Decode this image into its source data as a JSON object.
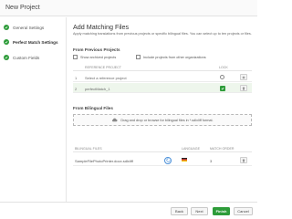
{
  "window": {
    "title": "New Project"
  },
  "steps": [
    {
      "label": "General Settings"
    },
    {
      "label": "Perfect Match Settings"
    },
    {
      "label": "Custom Fields"
    }
  ],
  "main": {
    "heading": "Add Matching Files",
    "description": "Apply matching translations from previous projects or specific bilingual files. You can select up to ten projects or files.",
    "previous_projects": {
      "heading": "From Previous Projects",
      "show_archived": "Show archived projects",
      "include_other_orgs": "Include projects from other organizations",
      "columns": {
        "reference": "REFERENCE PROJECT",
        "lock": "LOCK"
      },
      "rows": [
        {
          "num": "1",
          "name": "Select a reference project",
          "locked": false
        },
        {
          "num": "2",
          "name": "perfectMatch_1",
          "locked": true
        }
      ]
    },
    "bilingual": {
      "heading": "From Bilingual Files",
      "drop_text": "Drag and drop or browse for bilingual files in *.sdlxliff format.",
      "columns": {
        "files": "BILINGUAL FILES",
        "language": "LANGUAGE",
        "order": "MATCH ORDER"
      },
      "files": [
        {
          "name": "SampleFilePhotoPrinter.docx.sdlxliff",
          "language_icon": "german-flag-icon",
          "order": "3"
        }
      ]
    }
  },
  "footer": {
    "back": "Back",
    "next": "Next",
    "finish": "Finish",
    "cancel": "Cancel"
  },
  "colors": {
    "accent_green": "#2e9c3a",
    "link_blue": "#4a90d9"
  }
}
